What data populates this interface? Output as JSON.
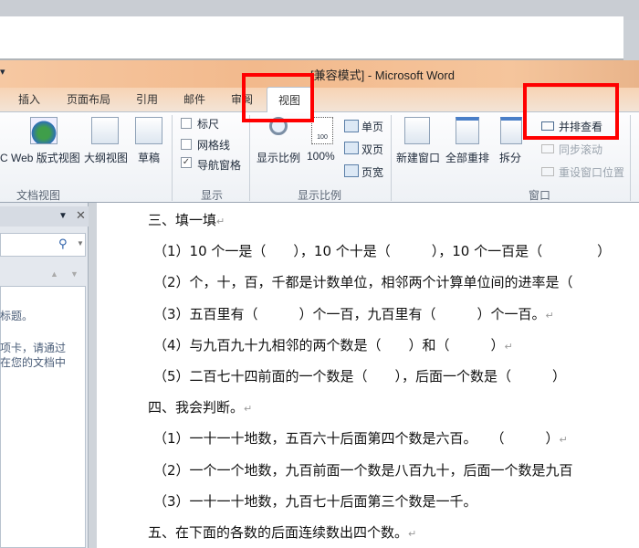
{
  "window": {
    "title": "[兼容模式] - Microsoft Word",
    "qat": "▾"
  },
  "tabs": [
    "插入",
    "页面布局",
    "引用",
    "邮件",
    "审阅",
    "视图"
  ],
  "ribbon": {
    "doc_views": {
      "items": [
        "Web 版式视图",
        "大纲视图",
        "草稿"
      ],
      "group": "文档视图",
      "cut_prefix": "C"
    },
    "show": {
      "items": [
        {
          "label": "标尺",
          "checked": false
        },
        {
          "label": "网格线",
          "checked": false
        },
        {
          "label": "导航窗格",
          "checked": true
        }
      ],
      "group": "显示"
    },
    "zoom": {
      "zoom_label": "显示比例",
      "hundred": "100%",
      "icon_text": "100",
      "single": "单页",
      "double": "双页",
      "width": "页宽",
      "group": "显示比例"
    },
    "window": {
      "new": "新建窗口",
      "arrange": "全部重排",
      "split": "拆分",
      "side": "并排查看",
      "sync": "同步滚动",
      "reset": "重设窗口位置",
      "group": "窗口"
    }
  },
  "nav": {
    "text1": "标题。",
    "text2": "项卡，请通过",
    "text3": "在您的文档中"
  },
  "doc": {
    "lines": [
      "三、填一填",
      "（1）10 个一是（　　），10 个十是（　　　），10 个一百是（　　　　）",
      "（2）个，十，百，千都是计数单位，相邻两个计算单位间的进率是（",
      "（3）五百里有（　　　）个一百，九百里有（　　　）个一百。",
      "（4）与九百九十九相邻的两个数是（　　）和（　　　）",
      "（5）二百七十四前面的一个数是（　　），后面一个数是（　　　）",
      "四、我会判断。",
      "（1）一十一十地数，五百六十后面第四个数是六百。　　（　　　）",
      "（2）一个一个地数，九百前面一个数是八百九十，后面一个数是九百",
      "（3）一十一十地数，九百七十后面第三个数是一千。",
      "五、在下面的各数的后面连续数出四个数。"
    ],
    "return_mark": "↵"
  },
  "colors": {
    "highlight": "#ff0000",
    "title_bar": "#f2b98c"
  }
}
